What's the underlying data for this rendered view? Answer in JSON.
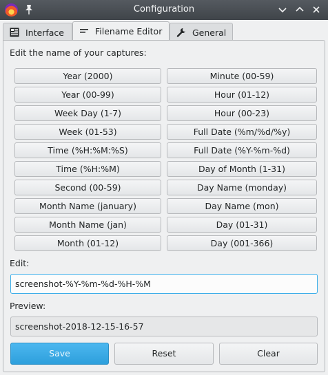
{
  "window": {
    "title": "Configuration"
  },
  "tabs": [
    {
      "label": "Interface",
      "icon": "interface-icon"
    },
    {
      "label": "Filename Editor",
      "icon": "filename-editor-icon"
    },
    {
      "label": "General",
      "icon": "wrench-icon"
    }
  ],
  "active_tab": "Filename Editor",
  "instruction": "Edit the name of your captures:",
  "buttons": {
    "left": [
      "Year (2000)",
      "Year (00-99)",
      "Week Day (1-7)",
      "Week (01-53)",
      "Time (%H:%M:%S)",
      "Time (%H:%M)",
      "Second (00-59)",
      "Month Name (january)",
      "Month Name (jan)",
      "Month (01-12)"
    ],
    "right": [
      "Minute (00-59)",
      "Hour (01-12)",
      "Hour (00-23)",
      "Full Date (%m/%d/%y)",
      "Full Date (%Y-%m-%d)",
      "Day of Month (1-31)",
      "Day Name (monday)",
      "Day Name (mon)",
      "Day (01-31)",
      "Day (001-366)"
    ]
  },
  "edit": {
    "label": "Edit:",
    "value": "screenshot-%Y-%m-%d-%H-%M"
  },
  "preview": {
    "label": "Preview:",
    "value": "screenshot-2018-12-15-16-57"
  },
  "actions": {
    "save": "Save",
    "reset": "Reset",
    "clear": "Clear"
  },
  "colors": {
    "titlebar": "#4a4f54",
    "accent": "#3daee9",
    "background": "#eff0f1"
  }
}
